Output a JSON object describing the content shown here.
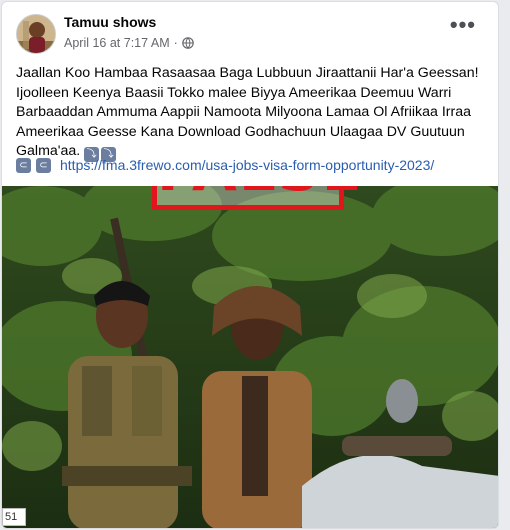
{
  "post": {
    "author": "Tamuu shows",
    "date": "April 16 at 7:17 AM",
    "separator": "·",
    "privacy_icon": "globe-icon",
    "more_icon": "more-options-icon",
    "text_lines": [
      "Jaallan Koo Hambaa Rasaasaa Baga Lubbuun Jiraattanii Har'a Geessan!",
      "Ijoolleen Keenya Baasii Tokko malee Biyya Ameerikaa Deemuu Warri",
      "Barbaaddan Ammuma Aappii Namoota Milyoona Lamaa Ol Afriikaa Irraa",
      "Ameerikaa Geesse Kana Download Godhachuun Ulaagaa DV Guutuun",
      "Galma'aa."
    ],
    "link_url": "https://fma.3frewo.com/usa-jobs-visa-form-opportunity-2023/"
  },
  "stamp": {
    "text": "FALSE",
    "color": "#e1161c"
  },
  "corner_badge": "51"
}
